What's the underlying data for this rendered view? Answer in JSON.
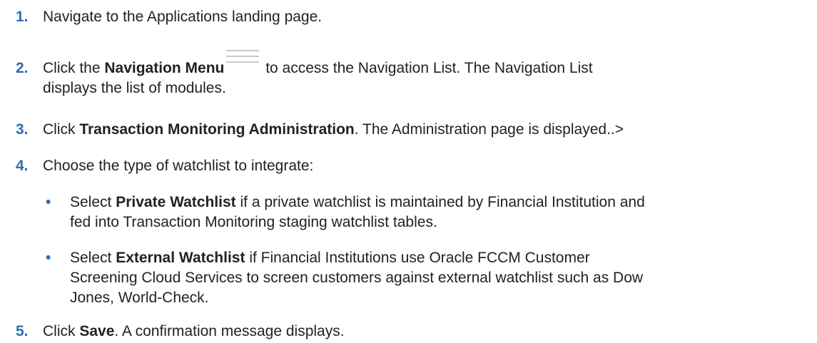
{
  "steps": [
    {
      "number": "1.",
      "text": "Navigate to the Applications landing page."
    },
    {
      "number": "2.",
      "prefix": "Click the ",
      "bold": "Navigation Menu",
      "icon": "hamburger-menu-icon",
      "suffix_line1": " to access the Navigation List. The Navigation List",
      "suffix_line2": "displays the list of modules."
    },
    {
      "number": "3.",
      "prefix": "Click ",
      "bold": "Transaction Monitoring Administration",
      "suffix": ". The Administration page is displayed..>"
    },
    {
      "number": "4.",
      "text": "Choose the type of watchlist to integrate:"
    },
    {
      "number": "5.",
      "prefix": "Click ",
      "bold": "Save",
      "suffix": ". A confirmation message displays."
    }
  ],
  "bullets": [
    {
      "prefix": "Select ",
      "bold": "Private Watchlist",
      "suffix_line1": " if a private watchlist is maintained by Financial Institution and",
      "suffix_line2": "fed into Transaction Monitoring staging watchlist tables."
    },
    {
      "prefix": "Select ",
      "bold": "External Watchlist",
      "suffix_line1": " if Financial Institutions use Oracle FCCM Customer",
      "suffix_line2": "Screening Cloud Services to screen customers against external watchlist such as Dow",
      "suffix_line3": "Jones, World-Check."
    }
  ],
  "bullet_marker": "•",
  "colors": {
    "number": "#2f6db4",
    "text": "#222222",
    "icon": "#c8c8c8"
  }
}
